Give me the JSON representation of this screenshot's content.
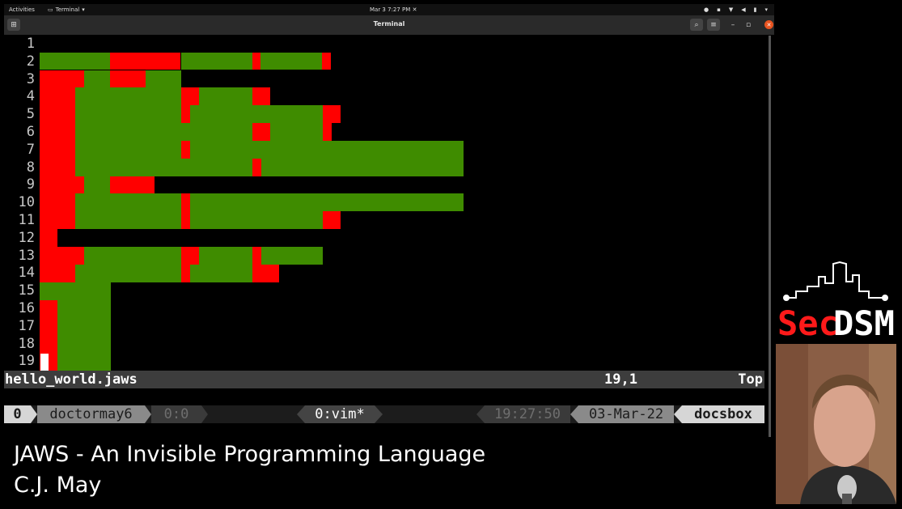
{
  "topbar": {
    "activities": "Activities",
    "app_name": "Terminal",
    "clock": "Mar 3  7:27 PM"
  },
  "window": {
    "title": "Terminal"
  },
  "editor": {
    "line_numbers": [
      "1",
      "2",
      "3",
      "4",
      "5",
      "6",
      "7",
      "8",
      "9",
      "10",
      "11",
      "12",
      "13",
      "14",
      "15",
      "16",
      "17",
      "18",
      "19"
    ],
    "filename": "hello_world.jaws",
    "position": "19,1",
    "scroll": "Top",
    "whitespace_colors": {
      "space": "#3f8c00",
      "tab": "#ff0000"
    }
  },
  "tmux": {
    "session": "0",
    "user": "doctormay6",
    "pane": "0:0",
    "window": "0:vim*",
    "time": "19:27:50",
    "date": "03-Mar-22",
    "host": "docsbox"
  },
  "caption": {
    "title": "JAWS - An Invisible Programming Language",
    "presenter": "C.J. May"
  },
  "logo": {
    "text_sec": "Sec",
    "text_dsm": "DSM",
    "sec_color": "#ff1a1a",
    "dsm_color": "#ffffff"
  }
}
